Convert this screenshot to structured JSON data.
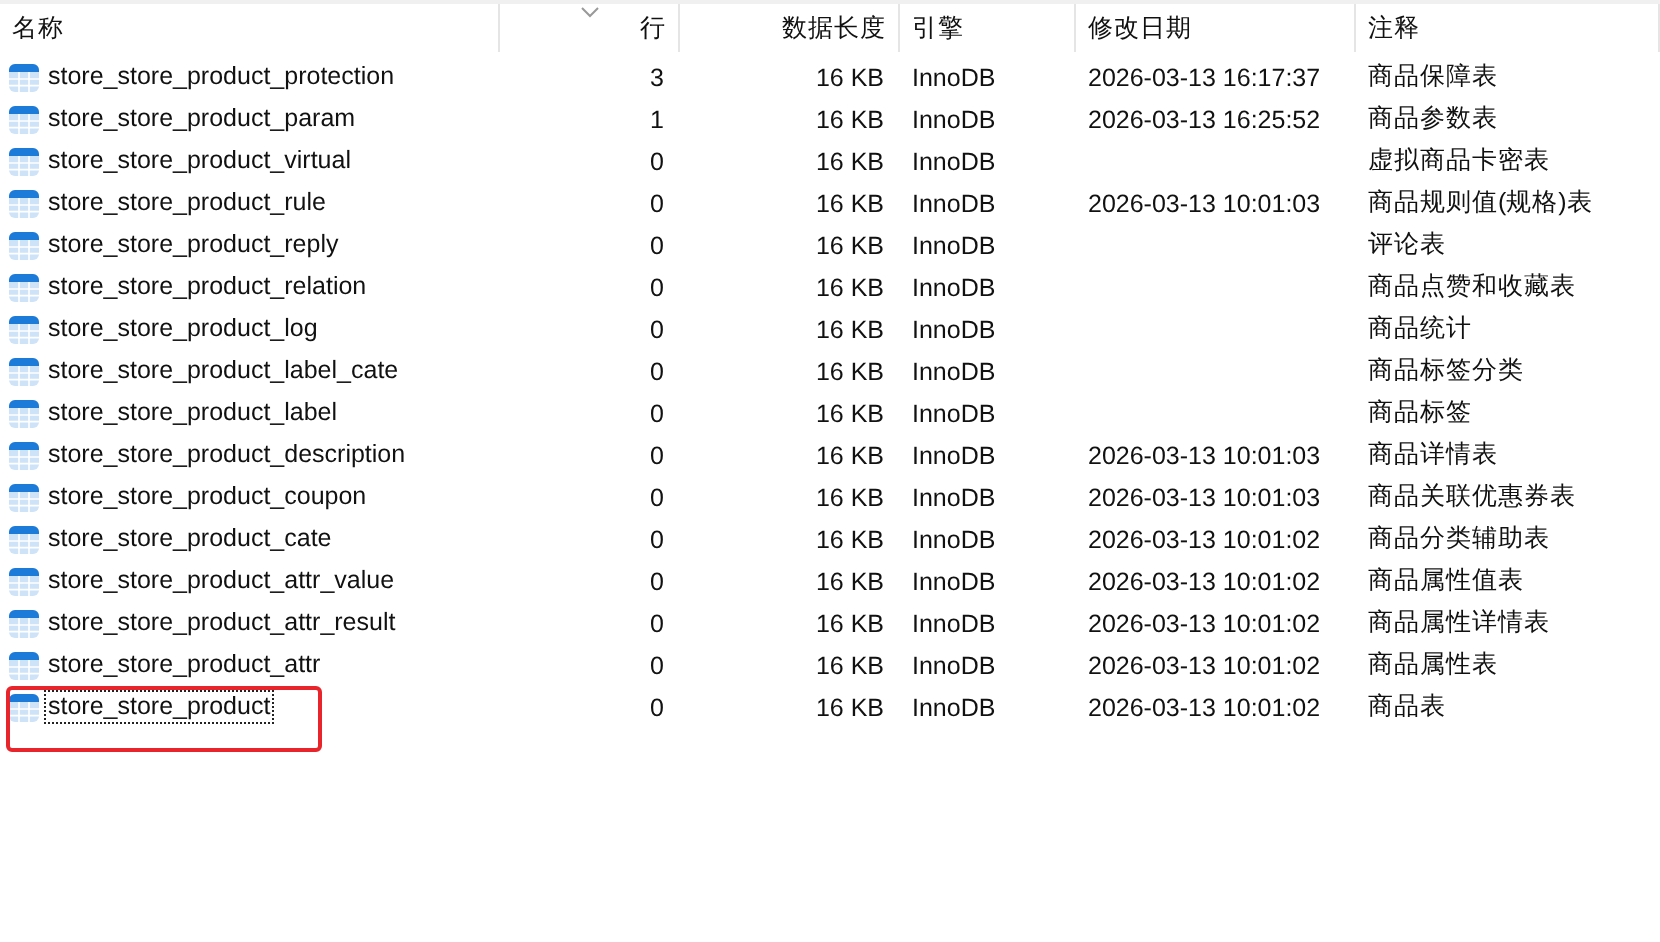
{
  "table": {
    "columns": [
      "名称",
      "行",
      "数据长度",
      "引擎",
      "修改日期",
      "注释"
    ],
    "rows": [
      {
        "name": "store_store_product_protection",
        "rows": "3",
        "data_length": "16 KB",
        "engine": "InnoDB",
        "modified": "2026-03-13 16:17:37",
        "comment": "商品保障表",
        "focused": false
      },
      {
        "name": "store_store_product_param",
        "rows": "1",
        "data_length": "16 KB",
        "engine": "InnoDB",
        "modified": "2026-03-13 16:25:52",
        "comment": "商品参数表",
        "focused": false
      },
      {
        "name": "store_store_product_virtual",
        "rows": "0",
        "data_length": "16 KB",
        "engine": "InnoDB",
        "modified": "",
        "comment": "虚拟商品卡密表",
        "focused": false
      },
      {
        "name": "store_store_product_rule",
        "rows": "0",
        "data_length": "16 KB",
        "engine": "InnoDB",
        "modified": "2026-03-13 10:01:03",
        "comment": "商品规则值(规格)表",
        "focused": false
      },
      {
        "name": "store_store_product_reply",
        "rows": "0",
        "data_length": "16 KB",
        "engine": "InnoDB",
        "modified": "",
        "comment": "评论表",
        "focused": false
      },
      {
        "name": "store_store_product_relation",
        "rows": "0",
        "data_length": "16 KB",
        "engine": "InnoDB",
        "modified": "",
        "comment": "商品点赞和收藏表",
        "focused": false
      },
      {
        "name": "store_store_product_log",
        "rows": "0",
        "data_length": "16 KB",
        "engine": "InnoDB",
        "modified": "",
        "comment": "商品统计",
        "focused": false
      },
      {
        "name": "store_store_product_label_cate",
        "rows": "0",
        "data_length": "16 KB",
        "engine": "InnoDB",
        "modified": "",
        "comment": "商品标签分类",
        "focused": false
      },
      {
        "name": "store_store_product_label",
        "rows": "0",
        "data_length": "16 KB",
        "engine": "InnoDB",
        "modified": "",
        "comment": "商品标签",
        "focused": false
      },
      {
        "name": "store_store_product_description",
        "rows": "0",
        "data_length": "16 KB",
        "engine": "InnoDB",
        "modified": "2026-03-13 10:01:03",
        "comment": "商品详情表",
        "focused": false
      },
      {
        "name": "store_store_product_coupon",
        "rows": "0",
        "data_length": "16 KB",
        "engine": "InnoDB",
        "modified": "2026-03-13 10:01:03",
        "comment": "商品关联优惠券表",
        "focused": false
      },
      {
        "name": "store_store_product_cate",
        "rows": "0",
        "data_length": "16 KB",
        "engine": "InnoDB",
        "modified": "2026-03-13 10:01:02",
        "comment": "商品分类辅助表",
        "focused": false
      },
      {
        "name": "store_store_product_attr_value",
        "rows": "0",
        "data_length": "16 KB",
        "engine": "InnoDB",
        "modified": "2026-03-13 10:01:02",
        "comment": "商品属性值表",
        "focused": false
      },
      {
        "name": "store_store_product_attr_result",
        "rows": "0",
        "data_length": "16 KB",
        "engine": "InnoDB",
        "modified": "2026-03-13 10:01:02",
        "comment": "商品属性详情表",
        "focused": false
      },
      {
        "name": "store_store_product_attr",
        "rows": "0",
        "data_length": "16 KB",
        "engine": "InnoDB",
        "modified": "2026-03-13 10:01:02",
        "comment": "商品属性表",
        "focused": false
      },
      {
        "name": "store_store_product",
        "rows": "0",
        "data_length": "16 KB",
        "engine": "InnoDB",
        "modified": "2026-03-13 10:01:02",
        "comment": "商品表",
        "focused": true,
        "highlighted": true
      }
    ]
  }
}
